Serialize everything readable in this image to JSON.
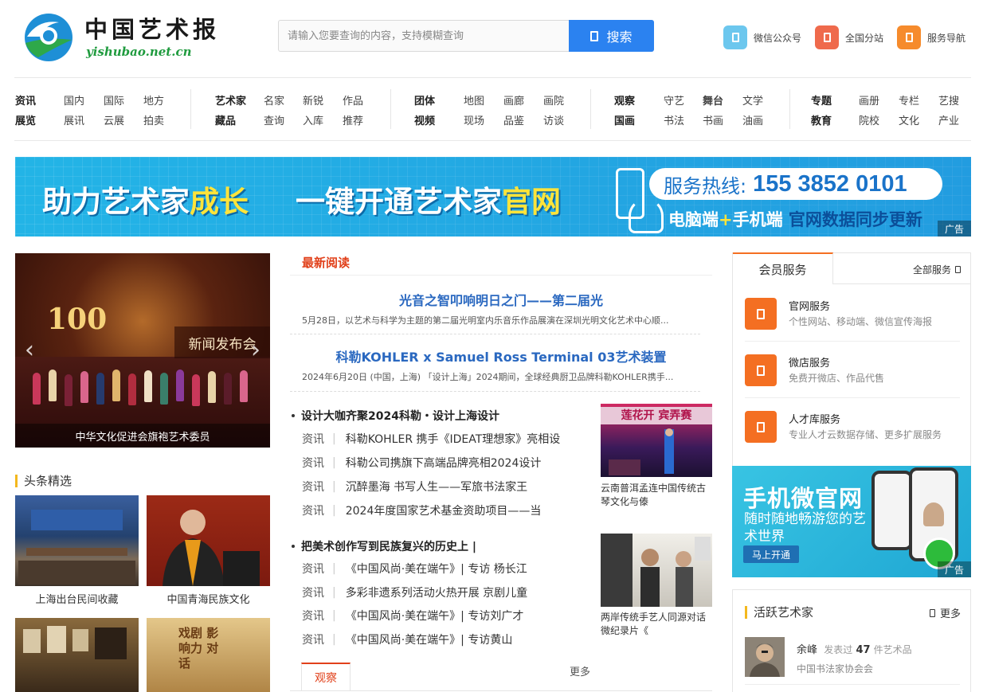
{
  "header": {
    "logo_cn": "中国艺术报",
    "logo_en": "yishubao.net.cn",
    "search_placeholder": "请输入您要查询的内容，支持模糊查询",
    "search_button": "搜索",
    "links": [
      {
        "label": "微信公众号",
        "color": "#6cc7ee",
        "icon": "wechat-icon"
      },
      {
        "label": "全国分站",
        "color": "#ef6a4c",
        "icon": "site-icon"
      },
      {
        "label": "服务导航",
        "color": "#f68b2c",
        "icon": "nav-icon"
      }
    ]
  },
  "nav": [
    {
      "row1": {
        "head": "资讯",
        "items": [
          "国内",
          "国际",
          "地方"
        ]
      },
      "row2": {
        "head": "展览",
        "items": [
          "展讯",
          "云展",
          "拍卖"
        ]
      }
    },
    {
      "row1": {
        "head": "艺术家",
        "items": [
          "名家",
          "新锐",
          "作品"
        ]
      },
      "row2": {
        "head": "藏品",
        "items": [
          "查询",
          "入库",
          "推荐"
        ]
      }
    },
    {
      "row1": {
        "head": "团体",
        "items": [
          "地图",
          "画廊",
          "画院"
        ]
      },
      "row2": {
        "head": "视频",
        "items": [
          "现场",
          "品鉴",
          "访谈"
        ]
      }
    },
    {
      "row1": {
        "head": "观察",
        "items": [
          "守艺",
          "舞台",
          "文学"
        ]
      },
      "row2": {
        "head": "国画",
        "items": [
          "书法",
          "书画",
          "油画"
        ]
      }
    },
    {
      "row1": {
        "head": "专题",
        "items": [
          "画册",
          "专栏",
          "艺搜"
        ]
      },
      "row2": {
        "head": "教育",
        "items": [
          "院校",
          "文化",
          "产业"
        ]
      }
    }
  ],
  "banner": {
    "part1": "助力艺术家",
    "part1_hl": "成长",
    "part2": "一键开通艺术家",
    "part2_hl": "官网",
    "hotline_label": "服务热线:",
    "hotline_number": "155 3852 0101",
    "sub_a": "电脑端",
    "sub_plus": "+",
    "sub_b": "手机端",
    "sub_c": "官网数据同步更新",
    "ad": "广告"
  },
  "slider": {
    "caption": "中华文化促进会旗袍艺术委员",
    "logo_text": "100",
    "board_text": "新闻发布会",
    "prev": "‹",
    "next": "›"
  },
  "headlines": {
    "title": "头条精选",
    "items": [
      {
        "caption": "上海出台民间收藏"
      },
      {
        "caption": "中国青海民族文化"
      }
    ],
    "bottom_overlay": "戏剧 影响力 对话"
  },
  "latest": {
    "title": "最新阅读",
    "featured": [
      {
        "title": "光音之智叩响明日之门——第二届光",
        "summary": "5月28日，以艺术与科学为主题的第二届光明室内乐音乐作品展演在深圳光明文化艺术中心顺..."
      },
      {
        "title": "科勒KOHLER x Samuel Ross Terminal 03艺术装置",
        "summary": "2024年6月20日 (中国，上海) 「设计上海」2024期间，全球经典厨卫品牌科勒KOHLER携手..."
      }
    ],
    "group1": {
      "head": "设计大咖齐聚2024科勒・设计上海设计",
      "items": [
        {
          "cat": "资讯",
          "text": "科勒KOHLER 携手《IDEAT理想家》亮相设"
        },
        {
          "cat": "资讯",
          "text": "科勒公司携旗下高端品牌亮相2024设计"
        },
        {
          "cat": "资讯",
          "text": "沉醉墨海 书写人生——军旅书法家王"
        },
        {
          "cat": "资讯",
          "text": "2024年度国家艺术基金资助项目——当"
        }
      ],
      "side_caption": "云南普洱孟连中国传统古琴文化与傣",
      "side_img_text": "莲花开 宾弄赛"
    },
    "group2": {
      "head": "把美术创作写到民族复兴的历史上 |",
      "items": [
        {
          "cat": "资讯",
          "text": "《中国风尚·美在端午》| 专访 杨长江"
        },
        {
          "cat": "资讯",
          "text": "多彩非遗系列活动火热开展 京剧儿童"
        },
        {
          "cat": "资讯",
          "text": "《中国风尚·美在端午》| 专访刘广才"
        },
        {
          "cat": "资讯",
          "text": "《中国风尚·美在端午》| 专访黄山"
        }
      ],
      "side_caption": "两岸传统手艺人同源对话微纪录片《"
    },
    "tab": "观察",
    "more": "更多"
  },
  "member": {
    "tab": "会员服务",
    "all": "全部服务",
    "services": [
      {
        "title": "官网服务",
        "desc": "个性网站、移动端、微信宣传海报"
      },
      {
        "title": "微店服务",
        "desc": "免费开微店、作品代售"
      },
      {
        "title": "人才库服务",
        "desc": "专业人才云数据存储、更多扩展服务"
      }
    ]
  },
  "mobile_ad": {
    "title": "手机微官网",
    "subtitle": "随时随地畅游您的艺术世界",
    "button": "马上开通",
    "ad": "广告"
  },
  "artists": {
    "title": "活跃艺术家",
    "more": "更多",
    "items": [
      {
        "name": "余峰",
        "posted_prefix": "发表过",
        "count": "47",
        "posted_suffix": "件艺术品",
        "org": "中国书法家协会会"
      }
    ]
  },
  "colors": {
    "accent_blue": "#2b82f0",
    "accent_orange": "#f46f22",
    "accent_red": "#e1401a",
    "title_blue": "#2a68c0",
    "section_bar": "#f3b81e"
  }
}
